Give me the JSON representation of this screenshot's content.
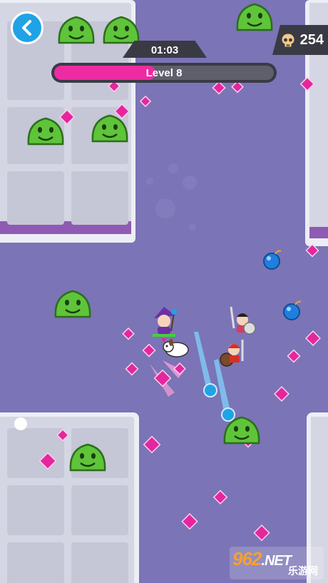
{
  "hud": {
    "back_icon": "chevron-left-icon",
    "timer": "01:03",
    "level_label": "Level 8",
    "xp_progress": 0.46,
    "kill_count": "254",
    "kill_icon": "skull-icon"
  },
  "colors": {
    "floor": "#7b74b6",
    "block": "#d7d8e4",
    "slime": "#5fc43a",
    "gem": "#e5269e",
    "xp_fill": "#ee2ba3",
    "accent": "#1fa3e6"
  },
  "watermark": {
    "text_top": "962",
    "text_tail": ".NET",
    "text_bottom": "乐游网"
  }
}
